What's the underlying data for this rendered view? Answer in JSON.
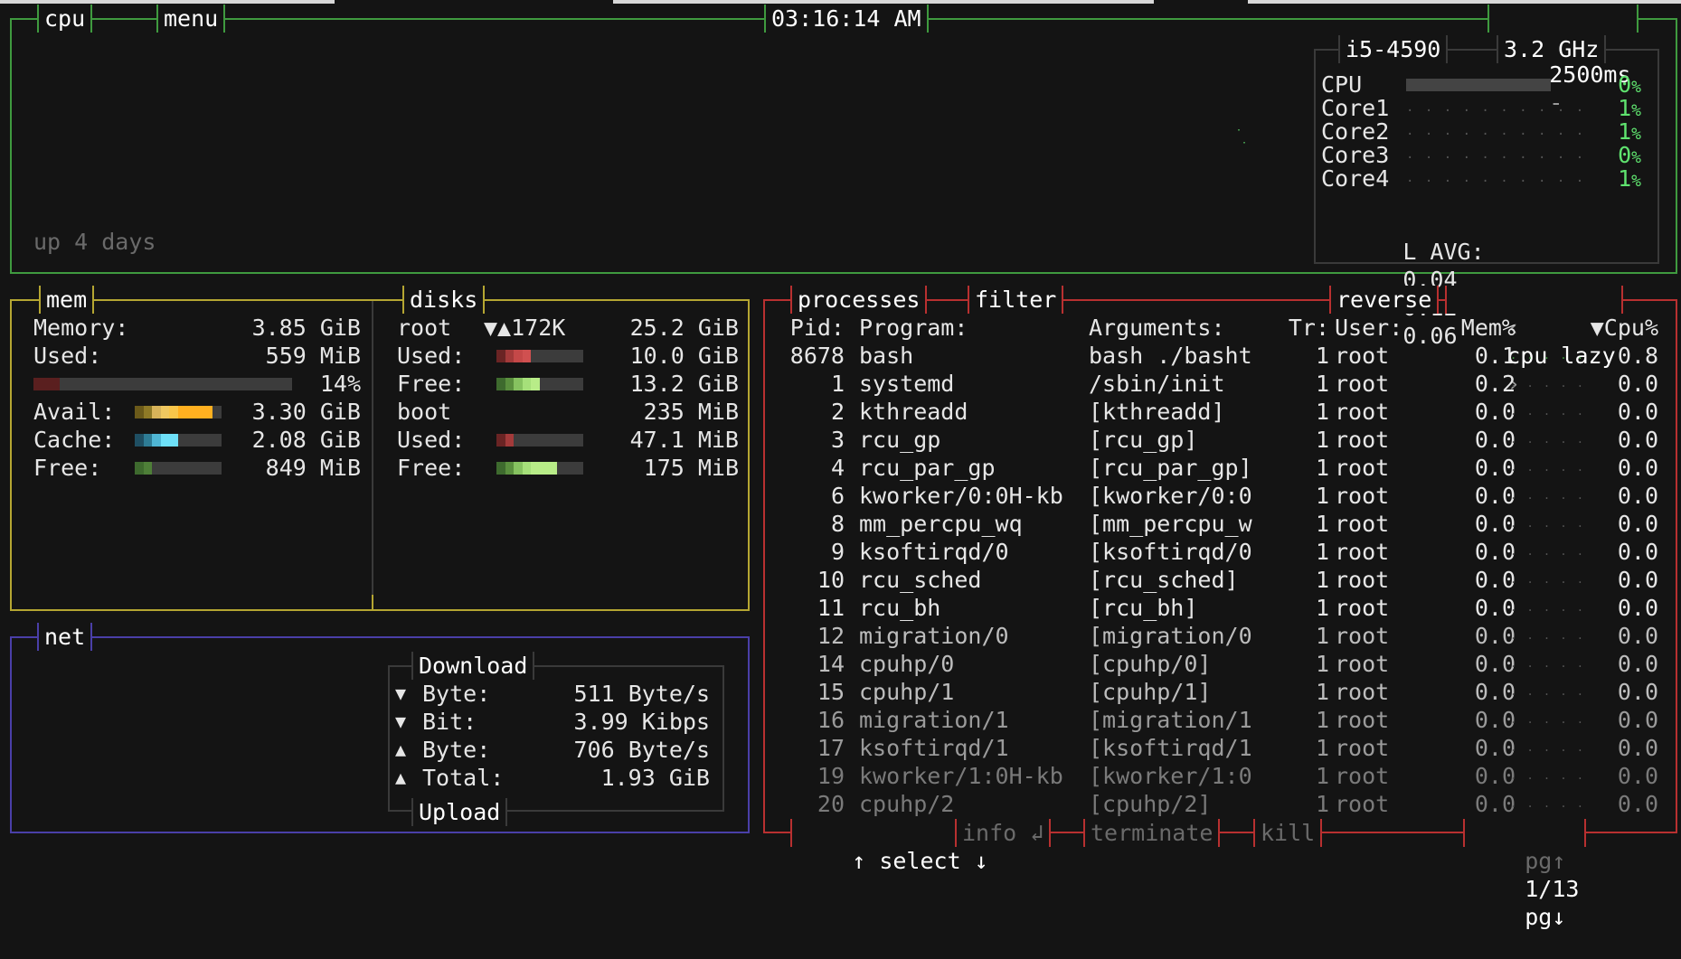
{
  "cpu_box": {
    "title": "cpu",
    "menu": "menu",
    "clock": "03:16:14 AM",
    "interval_plus": "+",
    "interval": "2500ms",
    "interval_minus": "-",
    "uptime": "up 4 days",
    "cpu_model": "i5-4590",
    "cpu_freq": "3.2 GHz",
    "rows": [
      {
        "label": "CPU",
        "value": "0",
        "unit": "%"
      },
      {
        "label": "Core1",
        "value": "1",
        "unit": "%"
      },
      {
        "label": "Core2",
        "value": "1",
        "unit": "%"
      },
      {
        "label": "Core3",
        "value": "0",
        "unit": "%"
      },
      {
        "label": "Core4",
        "value": "1",
        "unit": "%"
      }
    ],
    "load_avg_label": "L AVG:",
    "load_avg": [
      "0.04",
      "0.12",
      "0.06"
    ]
  },
  "mem_box": {
    "title": "mem",
    "memory_label": "Memory:",
    "memory_value": "3.85 GiB",
    "used_label": "Used:",
    "used_value": "559 MiB",
    "used_pct": "14%",
    "avail_label": "Avail:",
    "avail_value": "3.30 GiB",
    "cache_label": "Cache:",
    "cache_value": "2.08 GiB",
    "free_label": "Free:",
    "free_value": "849 MiB",
    "bars": {
      "used": 0.14,
      "avail": 0.86,
      "cache": 0.54,
      "free": 0.22
    }
  },
  "disks_box": {
    "title": "disks",
    "disks": [
      {
        "name": "root",
        "io": "▼▲172K",
        "total": "25.2 GiB",
        "used_label": "Used:",
        "used": "10.0 GiB",
        "used_frac": 0.4,
        "free_label": "Free:",
        "free": "13.2 GiB",
        "free_frac": 0.52
      },
      {
        "name": "boot",
        "io": "",
        "total": "235 MiB",
        "used_label": "Used:",
        "used": "47.1 MiB",
        "used_frac": 0.2,
        "free_label": "Free:",
        "free": "175 MiB",
        "free_frac": 0.74
      }
    ]
  },
  "net_box": {
    "title": "net",
    "download_label": "Download",
    "upload_label": "Upload",
    "rows": [
      {
        "arrow": "▼",
        "label": "Byte:",
        "value": "511 Byte/s"
      },
      {
        "arrow": "▼",
        "label": "Bit:",
        "value": "3.99 Kibps"
      },
      {
        "arrow": "▲",
        "label": "Byte:",
        "value": "706 Byte/s"
      },
      {
        "arrow": "▲",
        "label": "Total:",
        "value": "1.93 GiB"
      }
    ]
  },
  "proc_box": {
    "title": "processes",
    "filter": "filter",
    "reverse": "reverse",
    "sort_prev": "‹",
    "sort": "cpu lazy",
    "sort_next": "›",
    "headers": {
      "pid": "Pid:",
      "program": "Program:",
      "args": "Arguments:",
      "threads": "Tr:",
      "user": "User:",
      "mem": "Mem%",
      "cpu": "▼Cpu%"
    },
    "rows": [
      {
        "pid": "8678",
        "program": "bash",
        "args": "bash ./basht",
        "threads": "1",
        "user": "root",
        "mem": "0.1",
        "cpu": "0.8"
      },
      {
        "pid": "1",
        "program": "systemd",
        "args": "/sbin/init",
        "threads": "1",
        "user": "root",
        "mem": "0.2",
        "cpu": "0.0"
      },
      {
        "pid": "2",
        "program": "kthreadd",
        "args": "[kthreadd]",
        "threads": "1",
        "user": "root",
        "mem": "0.0",
        "cpu": "0.0"
      },
      {
        "pid": "3",
        "program": "rcu_gp",
        "args": "[rcu_gp]",
        "threads": "1",
        "user": "root",
        "mem": "0.0",
        "cpu": "0.0"
      },
      {
        "pid": "4",
        "program": "rcu_par_gp",
        "args": "[rcu_par_gp]",
        "threads": "1",
        "user": "root",
        "mem": "0.0",
        "cpu": "0.0"
      },
      {
        "pid": "6",
        "program": "kworker/0:0H-kb",
        "args": "[kworker/0:0",
        "threads": "1",
        "user": "root",
        "mem": "0.0",
        "cpu": "0.0"
      },
      {
        "pid": "8",
        "program": "mm_percpu_wq",
        "args": "[mm_percpu_w",
        "threads": "1",
        "user": "root",
        "mem": "0.0",
        "cpu": "0.0"
      },
      {
        "pid": "9",
        "program": "ksoftirqd/0",
        "args": "[ksoftirqd/0",
        "threads": "1",
        "user": "root",
        "mem": "0.0",
        "cpu": "0.0"
      },
      {
        "pid": "10",
        "program": "rcu_sched",
        "args": "[rcu_sched]",
        "threads": "1",
        "user": "root",
        "mem": "0.0",
        "cpu": "0.0"
      },
      {
        "pid": "11",
        "program": "rcu_bh",
        "args": "[rcu_bh]",
        "threads": "1",
        "user": "root",
        "mem": "0.0",
        "cpu": "0.0"
      },
      {
        "pid": "12",
        "program": "migration/0",
        "args": "[migration/0",
        "threads": "1",
        "user": "root",
        "mem": "0.0",
        "cpu": "0.0"
      },
      {
        "pid": "14",
        "program": "cpuhp/0",
        "args": "[cpuhp/0]",
        "threads": "1",
        "user": "root",
        "mem": "0.0",
        "cpu": "0.0"
      },
      {
        "pid": "15",
        "program": "cpuhp/1",
        "args": "[cpuhp/1]",
        "threads": "1",
        "user": "root",
        "mem": "0.0",
        "cpu": "0.0"
      },
      {
        "pid": "16",
        "program": "migration/1",
        "args": "[migration/1",
        "threads": "1",
        "user": "root",
        "mem": "0.0",
        "cpu": "0.0"
      },
      {
        "pid": "17",
        "program": "ksoftirqd/1",
        "args": "[ksoftirqd/1",
        "threads": "1",
        "user": "root",
        "mem": "0.0",
        "cpu": "0.0"
      },
      {
        "pid": "19",
        "program": "kworker/1:0H-kb",
        "args": "[kworker/1:0",
        "threads": "1",
        "user": "root",
        "mem": "0.0",
        "cpu": "0.0"
      },
      {
        "pid": "20",
        "program": "cpuhp/2",
        "args": "[cpuhp/2]",
        "threads": "1",
        "user": "root",
        "mem": "0.0",
        "cpu": "0.0"
      }
    ],
    "footer": {
      "select": "↑ select ↓",
      "info": "info ↲",
      "terminate": "terminate",
      "kill": "kill",
      "pgup": "pg↑",
      "page": "1/13",
      "pgdn": "pg↓"
    }
  },
  "colors": {
    "cpu": "#3f9a3f",
    "mem": "#b5a632",
    "net": "#4a3fa8",
    "proc": "#b83030",
    "value_green": "#5fe36f"
  }
}
